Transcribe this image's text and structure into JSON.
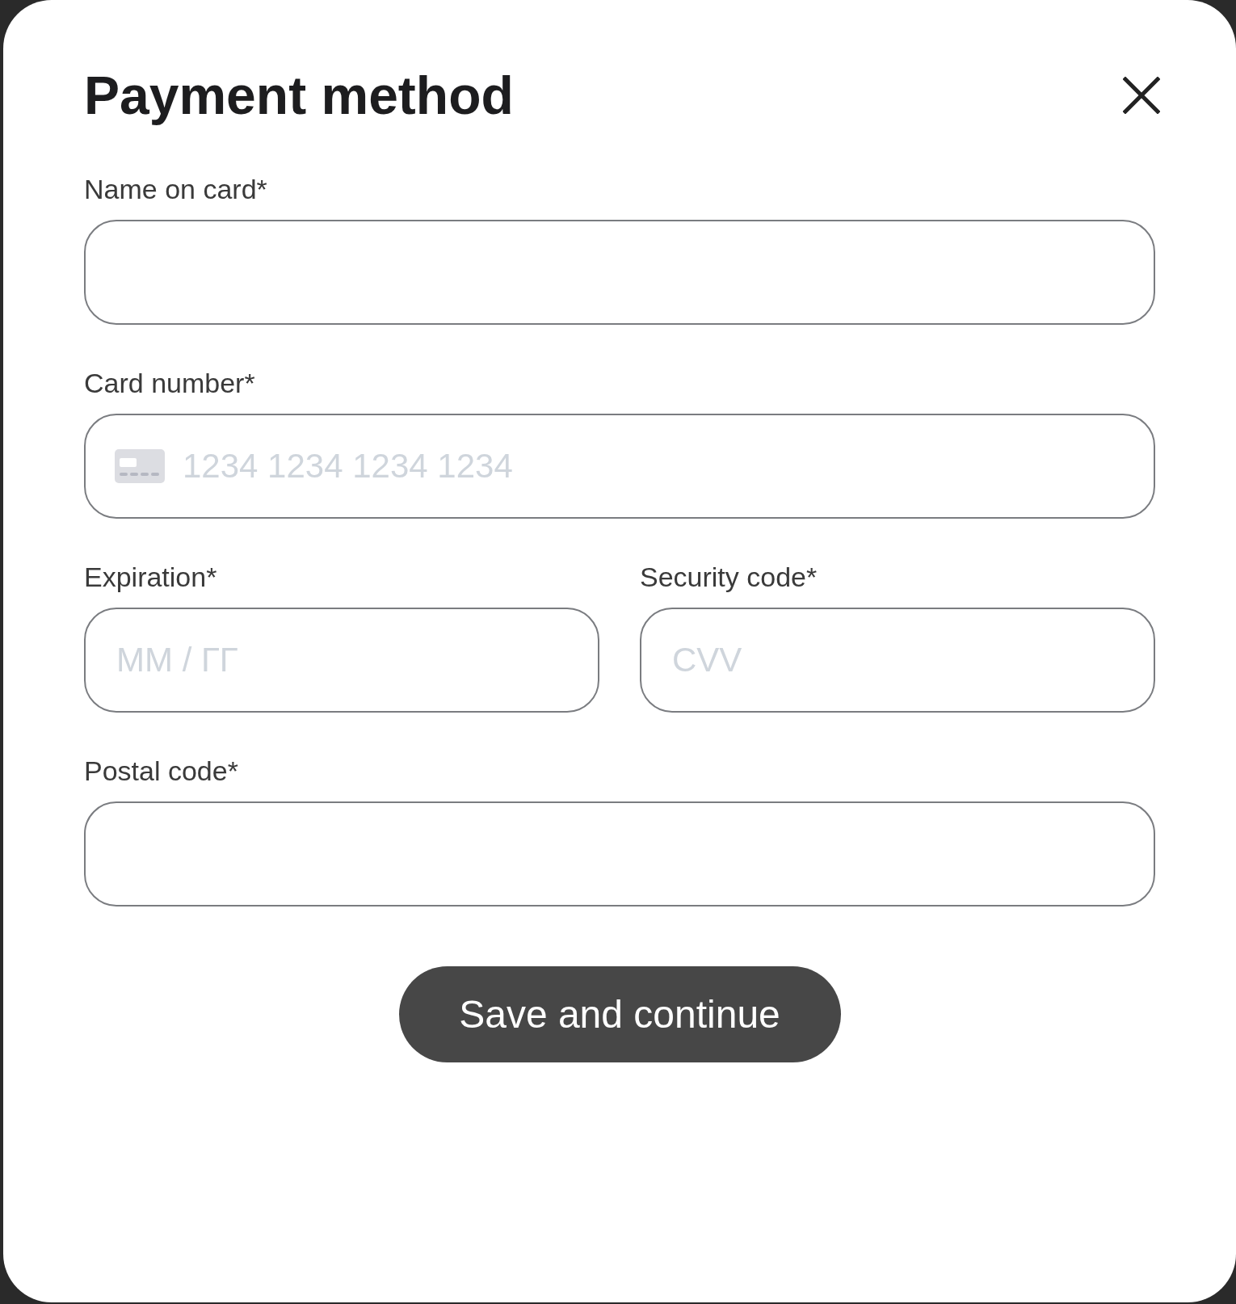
{
  "dialog": {
    "title": "Payment method"
  },
  "rows": [
    {
      "fields": [
        {
          "kind": "text",
          "label": "Name on card*"
        }
      ]
    },
    {
      "fields": [
        {
          "kind": "card",
          "label": "Card number*",
          "placeholder": "1234 1234 1234 1234"
        }
      ]
    },
    {
      "fields": [
        {
          "kind": "text",
          "label": "Expiration*",
          "placeholder": "MM / ГГ"
        },
        {
          "kind": "text",
          "label": "Security code*",
          "placeholder": "CVV"
        }
      ]
    },
    {
      "fields": [
        {
          "kind": "text",
          "label": "Postal code*"
        }
      ]
    }
  ],
  "submit_button": {
    "label": "Save and continue"
  }
}
